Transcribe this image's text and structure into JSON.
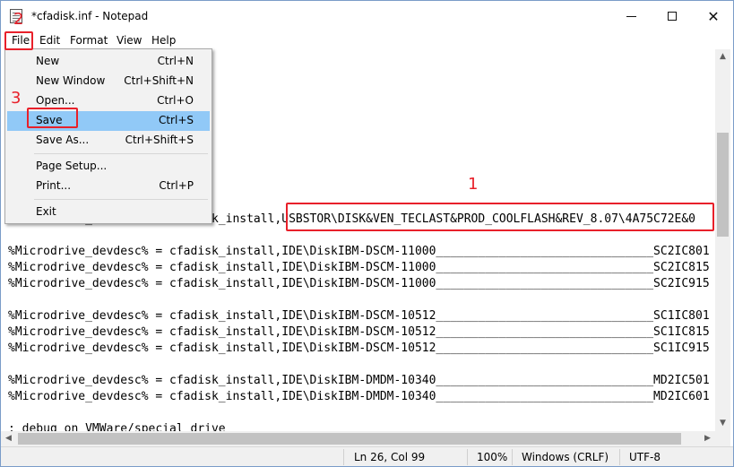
{
  "window": {
    "title": "*cfadisk.inf - Notepad"
  },
  "menu": [
    "File",
    "Edit",
    "Format",
    "View",
    "Help"
  ],
  "file_menu": [
    {
      "label": "New",
      "shortcut": "Ctrl+N"
    },
    {
      "label": "New Window",
      "shortcut": "Ctrl+Shift+N"
    },
    {
      "label": "Open...",
      "shortcut": "Ctrl+O"
    },
    {
      "label": "Save",
      "shortcut": "Ctrl+S"
    },
    {
      "label": "Save As...",
      "shortcut": "Ctrl+Shift+S"
    },
    {
      "label": "Page Setup...",
      "shortcut": ""
    },
    {
      "label": "Print...",
      "shortcut": "Ctrl+P"
    },
    {
      "label": "Exit",
      "shortcut": ""
    }
  ],
  "editor": {
    "lines": [
      "%Microdrive_devdesc% = cfadisk_install,USBSTOR\\DISK&VEN_TECLAST&PROD_COOLFLASH&REV_8.07\\4A75C72E&0",
      "",
      "%Microdrive_devdesc% = cfadisk_install,IDE\\DiskIBM-DSCM-11000_______________________________SC2IC801",
      "%Microdrive_devdesc% = cfadisk_install,IDE\\DiskIBM-DSCM-11000_______________________________SC2IC815",
      "%Microdrive_devdesc% = cfadisk_install,IDE\\DiskIBM-DSCM-11000_______________________________SC2IC915",
      "",
      "%Microdrive_devdesc% = cfadisk_install,IDE\\DiskIBM-DSCM-10512_______________________________SC1IC801",
      "%Microdrive_devdesc% = cfadisk_install,IDE\\DiskIBM-DSCM-10512_______________________________SC1IC815",
      "%Microdrive_devdesc% = cfadisk_install,IDE\\DiskIBM-DSCM-10512_______________________________SC1IC915",
      "",
      "%Microdrive_devdesc% = cfadisk_install,IDE\\DiskIBM-DMDM-10340_______________________________MD2IC501",
      "%Microdrive_devdesc% = cfadisk_install,IDE\\DiskIBM-DMDM-10340_______________________________MD2IC601",
      "",
      "; debug on VMWare/special drive"
    ]
  },
  "status": {
    "position": "Ln 26, Col 99",
    "zoom": "100%",
    "line_ending": "Windows (CRLF)",
    "encoding": "UTF-8"
  },
  "annotations": {
    "step1": "1",
    "step2": "2",
    "step3": "3"
  },
  "colors": {
    "highlight": "#e8202a",
    "selection": "#91c9f7"
  }
}
